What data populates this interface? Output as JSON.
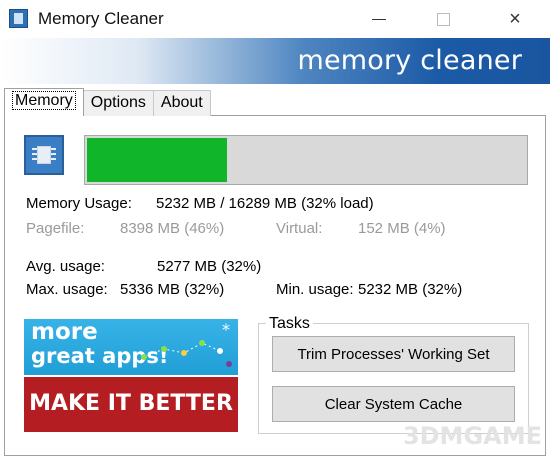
{
  "window": {
    "title": "Memory Cleaner",
    "controls": {
      "minimize": "minimize-icon",
      "maximize": "maximize-icon",
      "close": "×"
    }
  },
  "banner": {
    "text": "memory cleaner"
  },
  "tabs": [
    {
      "label": "Memory",
      "active": true
    },
    {
      "label": "Options",
      "active": false
    },
    {
      "label": "About",
      "active": false
    }
  ],
  "memory": {
    "usage_fraction": 0.32,
    "bar_color": "#10b52a",
    "usage_label": "Memory Usage:",
    "usage_value": "5232 MB / 16289 MB  (32% load)",
    "pagefile_label": "Pagefile:",
    "pagefile_value": "8398 MB (46%)",
    "virtual_label": "Virtual:",
    "virtual_value": "152 MB (4%)",
    "avg_label": "Avg. usage:",
    "avg_value": "5277 MB (32%)",
    "max_label": "Max. usage:",
    "max_value": "5336 MB (32%)",
    "min_label": "Min. usage:",
    "min_value": "5232 MB (32%)"
  },
  "promo": {
    "line1": "more",
    "line2": "great apps!",
    "make_better": "MAKE IT BETTER"
  },
  "tasks": {
    "legend": "Tasks",
    "trim_button": "Trim Processes' Working Set",
    "clear_button": "Clear System Cache"
  },
  "watermark": "3DMGAME"
}
